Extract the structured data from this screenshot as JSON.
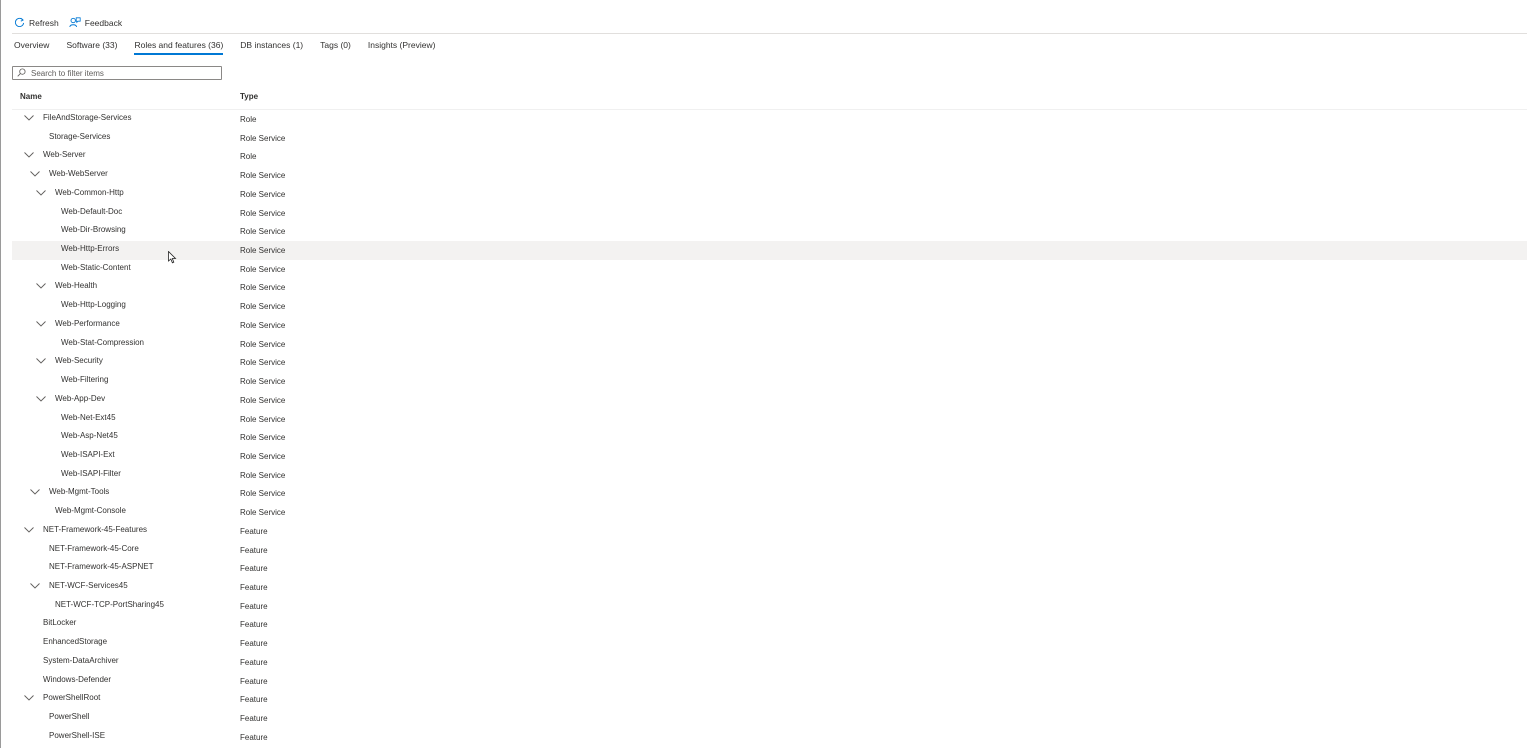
{
  "toolbar": {
    "refresh_label": "Refresh",
    "feedback_label": "Feedback"
  },
  "tabs": [
    {
      "label": "Overview"
    },
    {
      "label": "Software (33)"
    },
    {
      "label": "Roles and features (36)",
      "active": true
    },
    {
      "label": "DB instances (1)"
    },
    {
      "label": "Tags (0)"
    },
    {
      "label": "Insights (Preview)"
    }
  ],
  "search": {
    "placeholder": "Search to filter items",
    "value": ""
  },
  "table": {
    "columns": [
      "Name",
      "Type"
    ],
    "rows": [
      {
        "name": "FileAndStorage-Services",
        "type": "Role",
        "level": 0,
        "expanded": true
      },
      {
        "name": "Storage-Services",
        "type": "Role Service",
        "level": 1,
        "expanded": false
      },
      {
        "name": "Web-Server",
        "type": "Role",
        "level": 0,
        "expanded": true
      },
      {
        "name": "Web-WebServer",
        "type": "Role Service",
        "level": 1,
        "expanded": true
      },
      {
        "name": "Web-Common-Http",
        "type": "Role Service",
        "level": 2,
        "expanded": true
      },
      {
        "name": "Web-Default-Doc",
        "type": "Role Service",
        "level": 3,
        "expanded": false
      },
      {
        "name": "Web-Dir-Browsing",
        "type": "Role Service",
        "level": 3,
        "expanded": false
      },
      {
        "name": "Web-Http-Errors",
        "type": "Role Service",
        "level": 3,
        "expanded": false,
        "hover": true
      },
      {
        "name": "Web-Static-Content",
        "type": "Role Service",
        "level": 3,
        "expanded": false
      },
      {
        "name": "Web-Health",
        "type": "Role Service",
        "level": 2,
        "expanded": true
      },
      {
        "name": "Web-Http-Logging",
        "type": "Role Service",
        "level": 3,
        "expanded": false
      },
      {
        "name": "Web-Performance",
        "type": "Role Service",
        "level": 2,
        "expanded": true
      },
      {
        "name": "Web-Stat-Compression",
        "type": "Role Service",
        "level": 3,
        "expanded": false
      },
      {
        "name": "Web-Security",
        "type": "Role Service",
        "level": 2,
        "expanded": true
      },
      {
        "name": "Web-Filtering",
        "type": "Role Service",
        "level": 3,
        "expanded": false
      },
      {
        "name": "Web-App-Dev",
        "type": "Role Service",
        "level": 2,
        "expanded": true
      },
      {
        "name": "Web-Net-Ext45",
        "type": "Role Service",
        "level": 3,
        "expanded": false
      },
      {
        "name": "Web-Asp-Net45",
        "type": "Role Service",
        "level": 3,
        "expanded": false
      },
      {
        "name": "Web-ISAPI-Ext",
        "type": "Role Service",
        "level": 3,
        "expanded": false
      },
      {
        "name": "Web-ISAPI-Filter",
        "type": "Role Service",
        "level": 3,
        "expanded": false
      },
      {
        "name": "Web-Mgmt-Tools",
        "type": "Role Service",
        "level": 1,
        "expanded": true
      },
      {
        "name": "Web-Mgmt-Console",
        "type": "Role Service",
        "level": 2,
        "expanded": false
      },
      {
        "name": "NET-Framework-45-Features",
        "type": "Feature",
        "level": 0,
        "expanded": true
      },
      {
        "name": "NET-Framework-45-Core",
        "type": "Feature",
        "level": 1,
        "expanded": false
      },
      {
        "name": "NET-Framework-45-ASPNET",
        "type": "Feature",
        "level": 1,
        "expanded": false
      },
      {
        "name": "NET-WCF-Services45",
        "type": "Feature",
        "level": 1,
        "expanded": true
      },
      {
        "name": "NET-WCF-TCP-PortSharing45",
        "type": "Feature",
        "level": 2,
        "expanded": false
      },
      {
        "name": "BitLocker",
        "type": "Feature",
        "level": 0,
        "expanded": false
      },
      {
        "name": "EnhancedStorage",
        "type": "Feature",
        "level": 0,
        "expanded": false
      },
      {
        "name": "System-DataArchiver",
        "type": "Feature",
        "level": 0,
        "expanded": false
      },
      {
        "name": "Windows-Defender",
        "type": "Feature",
        "level": 0,
        "expanded": false
      },
      {
        "name": "PowerShellRoot",
        "type": "Feature",
        "level": 0,
        "expanded": true
      },
      {
        "name": "PowerShell",
        "type": "Feature",
        "level": 1,
        "expanded": false
      },
      {
        "name": "PowerShell-ISE",
        "type": "Feature",
        "level": 1,
        "expanded": false
      }
    ]
  },
  "icons": {
    "refresh": "refresh-icon",
    "feedback": "feedback-icon",
    "search": "search-icon",
    "chevron": "chevron-down-icon",
    "cursor": "mouse-pointer-icon"
  },
  "colors": {
    "accent": "#0078d4",
    "hover_row": "#f3f2f1",
    "text": "#323130"
  }
}
